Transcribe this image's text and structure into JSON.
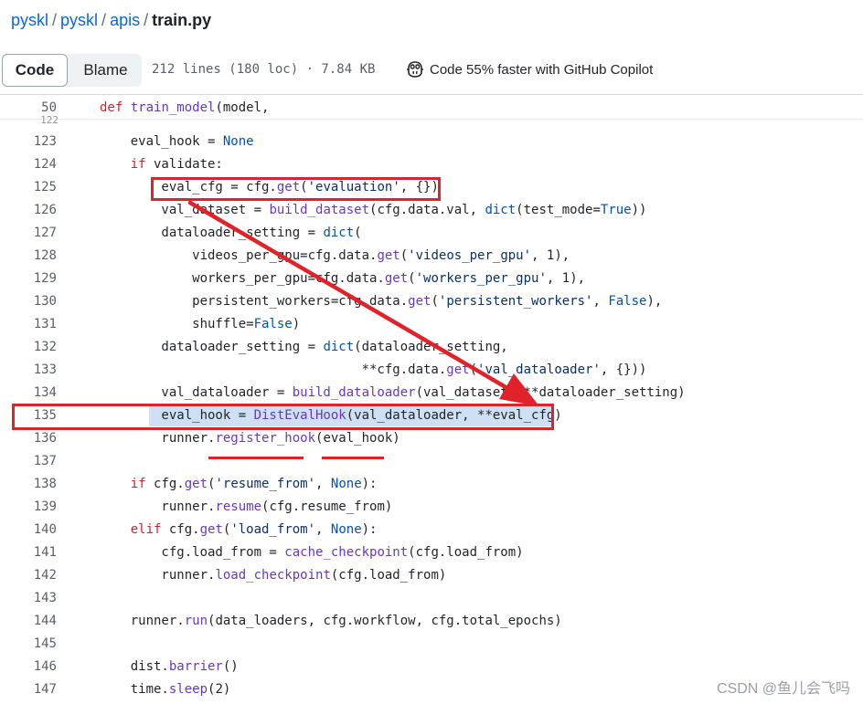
{
  "breadcrumb": {
    "repo": "pyskl",
    "sep": "/",
    "dir1": "pyskl",
    "dir2": "apis",
    "file": "train.py"
  },
  "toolbar": {
    "code_label": "Code",
    "blame_label": "Blame",
    "file_meta": "212 lines (180 loc) · 7.84 KB",
    "copilot_label": "Code 55% faster with GitHub Copilot"
  },
  "sticky_header": {
    "number": "50",
    "text": "def train_model(model,"
  },
  "peek_number": "122",
  "code_lines": [
    {
      "n": "123",
      "t": "    eval_hook = None"
    },
    {
      "n": "124",
      "t": "    if validate:"
    },
    {
      "n": "125",
      "t": "        eval_cfg = cfg.get('evaluation', {})"
    },
    {
      "n": "126",
      "t": "        val_dataset = build_dataset(cfg.data.val, dict(test_mode=True))"
    },
    {
      "n": "127",
      "t": "        dataloader_setting = dict("
    },
    {
      "n": "128",
      "t": "            videos_per_gpu=cfg.data.get('videos_per_gpu', 1),"
    },
    {
      "n": "129",
      "t": "            workers_per_gpu=cfg.data.get('workers_per_gpu', 1),"
    },
    {
      "n": "130",
      "t": "            persistent_workers=cfg.data.get('persistent_workers', False),"
    },
    {
      "n": "131",
      "t": "            shuffle=False)"
    },
    {
      "n": "132",
      "t": "        dataloader_setting = dict(dataloader_setting,"
    },
    {
      "n": "133",
      "t": "                                  **cfg.data.get('val_dataloader', {}))"
    },
    {
      "n": "134",
      "t": "        val_dataloader = build_dataloader(val_dataset, **dataloader_setting)"
    },
    {
      "n": "135",
      "t": "        eval_hook = DistEvalHook(val_dataloader, **eval_cfg)"
    },
    {
      "n": "136",
      "t": "        runner.register_hook(eval_hook)"
    },
    {
      "n": "137",
      "t": ""
    },
    {
      "n": "138",
      "t": "    if cfg.get('resume_from', None):"
    },
    {
      "n": "139",
      "t": "        runner.resume(cfg.resume_from)"
    },
    {
      "n": "140",
      "t": "    elif cfg.get('load_from', None):"
    },
    {
      "n": "141",
      "t": "        cfg.load_from = cache_checkpoint(cfg.load_from)"
    },
    {
      "n": "142",
      "t": "        runner.load_checkpoint(cfg.load_from)"
    },
    {
      "n": "143",
      "t": ""
    },
    {
      "n": "144",
      "t": "    runner.run(data_loaders, cfg.workflow, cfg.total_epochs)"
    },
    {
      "n": "145",
      "t": ""
    },
    {
      "n": "146",
      "t": "    dist.barrier()"
    },
    {
      "n": "147",
      "t": "    time.sleep(2)"
    }
  ],
  "watermark": "CSDN @鱼儿会飞吗",
  "colors": {
    "annotation_red": "#e0222a",
    "highlight_blue": "#cfe0f5",
    "link_blue": "#0969da",
    "keyword_red": "#cf222e",
    "function_purple": "#6639ba",
    "builtin_blue": "#0550ae",
    "string_navy": "#0a3069"
  },
  "icons": {
    "copilot": "copilot-icon"
  }
}
